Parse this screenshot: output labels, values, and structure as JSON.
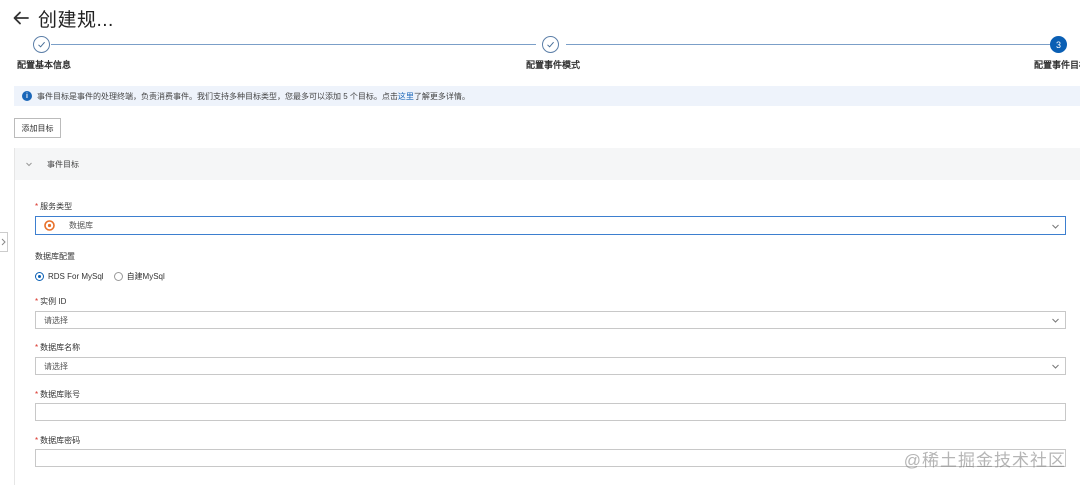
{
  "header": {
    "title": "创建规..."
  },
  "steps": [
    {
      "label": "配置基本信息",
      "state": "done",
      "number": ""
    },
    {
      "label": "配置事件模式",
      "state": "done",
      "number": ""
    },
    {
      "label": "配置事件目标",
      "state": "active",
      "number": "3"
    }
  ],
  "info": {
    "text": "事件目标是事件的处理终端，负责消费事件。我们支持多种目标类型，您最多可以添加 5 个目标。点击",
    "link": "这里",
    "suffix": "了解更多详情。"
  },
  "toolbar": {
    "add_target_label": "添加目标"
  },
  "panel": {
    "title": "事件目标"
  },
  "form": {
    "service_type": {
      "label": "服务类型",
      "value": "数据库"
    },
    "db_config": {
      "label": "数据库配置"
    },
    "radio_options": [
      {
        "label": "RDS For MySql",
        "checked": true
      },
      {
        "label": "自建MySql",
        "checked": false
      }
    ],
    "instance_id": {
      "label": "实例 ID",
      "placeholder": "请选择"
    },
    "db_name": {
      "label": "数据库名称",
      "placeholder": "请选择"
    },
    "db_account": {
      "label": "数据库账号",
      "value": ""
    },
    "db_password": {
      "label": "数据库密码",
      "value": ""
    }
  },
  "watermark": {
    "text": "@稀土掘金技术社区"
  },
  "colors": {
    "accent": "#0a5fb4",
    "required": "#d93026",
    "info_bg": "#eef3fb",
    "brand_icon": "#e8702a"
  }
}
